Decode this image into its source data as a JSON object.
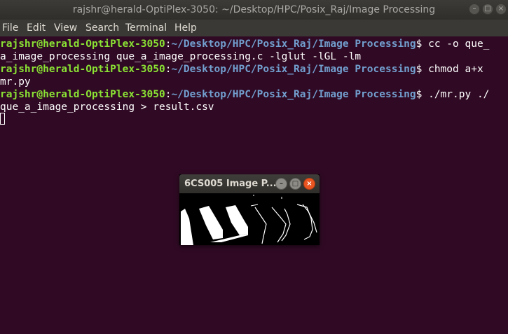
{
  "window": {
    "title": "rajshr@herald-OptiPlex-3050: ~/Desktop/HPC/Posix_Raj/Image Processing"
  },
  "menu": {
    "items": [
      "File",
      "Edit",
      "View",
      "Search",
      "Terminal",
      "Help"
    ]
  },
  "terminal": {
    "lines": [
      {
        "user": "rajshr@herald-OptiPlex-3050",
        "sep": ":",
        "path": "~/Desktop/HPC/Posix_Raj/Image Processing",
        "text": "$ cc -o que_"
      },
      {
        "user": "",
        "sep": "",
        "path": "",
        "text": "a_image_processing que_a_image_processing.c -lglut -lGL -lm"
      },
      {
        "user": "rajshr@herald-OptiPlex-3050",
        "sep": ":",
        "path": "~/Desktop/HPC/Posix_Raj/Image Processing",
        "text": "$ chmod a+x"
      },
      {
        "user": "",
        "sep": "",
        "path": "",
        "text": "mr.py"
      },
      {
        "user": "rajshr@herald-OptiPlex-3050",
        "sep": ":",
        "path": "~/Desktop/HPC/Posix_Raj/Image Processing",
        "text": "$ ./mr.py ./"
      },
      {
        "user": "",
        "sep": "",
        "path": "",
        "text": "que_a_image_processing > result.csv"
      }
    ]
  },
  "image_window": {
    "title": "6CS005 Image P..."
  },
  "colors": {
    "background": "#300a24",
    "user": "#8ae234",
    "path": "#729fcf",
    "close_button": "#e95420"
  }
}
